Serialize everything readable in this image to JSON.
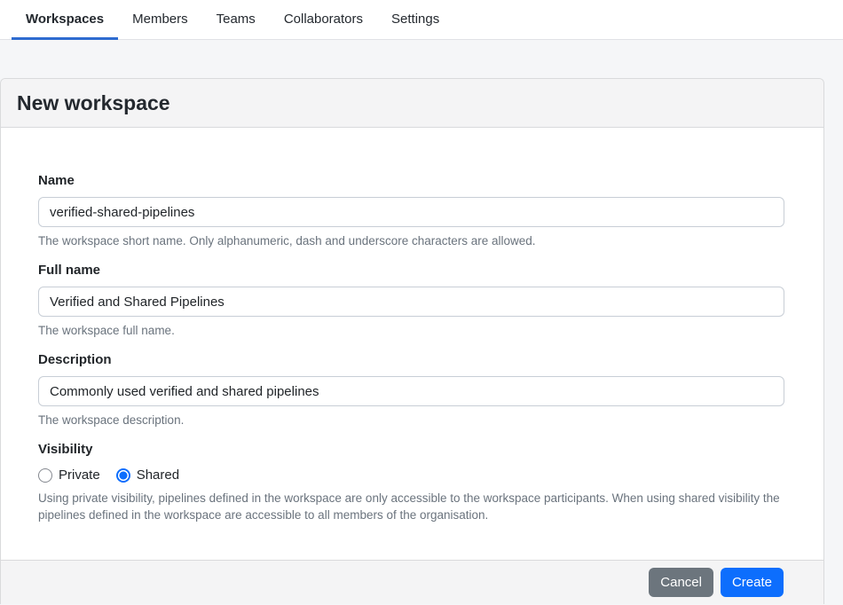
{
  "nav": {
    "tabs": [
      {
        "label": "Workspaces",
        "active": true
      },
      {
        "label": "Members",
        "active": false
      },
      {
        "label": "Teams",
        "active": false
      },
      {
        "label": "Collaborators",
        "active": false
      },
      {
        "label": "Settings",
        "active": false
      }
    ]
  },
  "card": {
    "title": "New workspace",
    "form": {
      "name": {
        "label": "Name",
        "value": "verified-shared-pipelines",
        "help": "The workspace short name. Only alphanumeric, dash and underscore characters are allowed."
      },
      "full_name": {
        "label": "Full name",
        "value": "Verified and Shared Pipelines",
        "help": "The workspace full name."
      },
      "description": {
        "label": "Description",
        "value": "Commonly used verified and shared pipelines",
        "help": "The workspace description."
      },
      "visibility": {
        "label": "Visibility",
        "options": [
          {
            "label": "Private",
            "selected": false
          },
          {
            "label": "Shared",
            "selected": true
          }
        ],
        "help": "Using private visibility, pipelines defined in the workspace are only accessible to the workspace participants. When using shared visibility the pipelines defined in the workspace are accessible to all members of the organisation."
      }
    },
    "footer": {
      "cancel_label": "Cancel",
      "create_label": "Create"
    }
  },
  "colors": {
    "tab_underline": "#2e6bd0",
    "primary_blue": "#0d6efd",
    "cancel_gray": "#6c757d"
  }
}
